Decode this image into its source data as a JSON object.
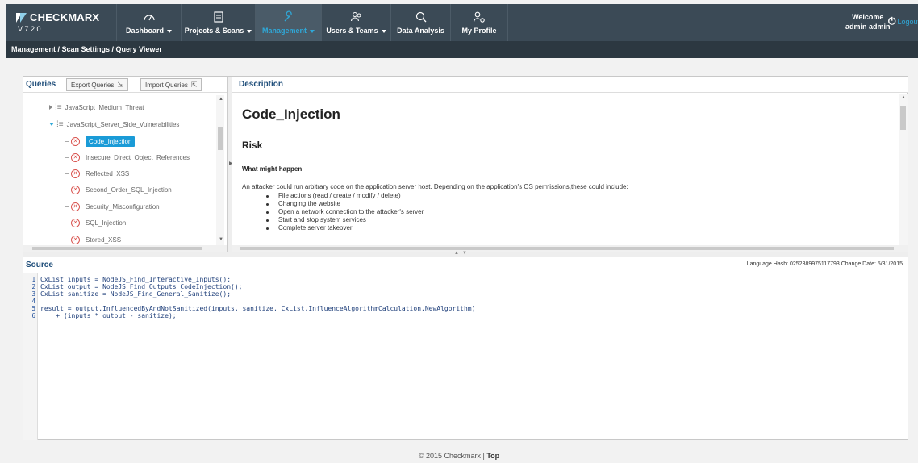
{
  "brand": {
    "name": "CHECKMARX",
    "version": "V 7.2.0"
  },
  "nav": {
    "items": [
      {
        "label": "Dashboard",
        "icon": "gauge-icon",
        "dropdown": true
      },
      {
        "label": "Projects & Scans",
        "icon": "document-icon",
        "dropdown": true
      },
      {
        "label": "Management",
        "icon": "wrench-icon",
        "dropdown": true,
        "active": true
      },
      {
        "label": "Users & Teams",
        "icon": "users-icon",
        "dropdown": true
      },
      {
        "label": "Data Analysis",
        "icon": "magnifier-icon",
        "dropdown": false
      },
      {
        "label": "My Profile",
        "icon": "user-gear-icon",
        "dropdown": false
      }
    ],
    "welcome_line1": "Welcome",
    "welcome_line2": "admin admin",
    "logout": "Logout"
  },
  "breadcrumb": "Management / Scan Settings / Query Viewer",
  "queries": {
    "title": "Queries",
    "export_label": "Export Queries",
    "import_label": "Import Queries",
    "groups": [
      {
        "label": "JavaScript_Medium_Threat",
        "expanded": false
      },
      {
        "label": "JavaScript_Server_Side_Vulnerabilities",
        "expanded": true
      }
    ],
    "items": [
      {
        "label": "Code_Injection",
        "selected": true
      },
      {
        "label": "Insecure_Direct_Object_References"
      },
      {
        "label": "Reflected_XSS"
      },
      {
        "label": "Second_Order_SQL_Injection"
      },
      {
        "label": "Security_Misconfiguration"
      },
      {
        "label": "SQL_Injection"
      },
      {
        "label": "Stored_XSS"
      }
    ]
  },
  "description": {
    "title": "Description",
    "heading": "Code_Injection",
    "risk": "Risk",
    "what_happens": "What might happen",
    "paragraph": "An attacker could run arbitrary code on the application server host. Depending on the application's OS permissions,these could include:",
    "bullets": [
      "File actions (read / create / modify / delete)",
      "Changing the website",
      "Open a network connection to the attacker's server",
      "Start and stop system services",
      "Complete server takeover"
    ]
  },
  "source": {
    "title": "Source",
    "lang_hash": "Language Hash: 0252389975117793 Change Date: 5/31/2015",
    "lines": [
      "CxList inputs = NodeJS_Find_Interactive_Inputs();",
      "CxList output = NodeJS_Find_Outputs_CodeInjection();",
      "CxList sanitize = NodeJS_Find_General_Sanitize();",
      "",
      "result = output.InfluencedByAndNotSanitized(inputs, sanitize, CxList.InfluenceAlgorithmCalculation.NewAlgorithm)",
      "    + (inputs * output - sanitize);"
    ],
    "line_numbers": [
      "1",
      "2",
      "3",
      "4",
      "5",
      "6"
    ]
  },
  "footer": {
    "copyright": "© 2015 Checkmarx | ",
    "top_link": "Top"
  },
  "colors": {
    "nav_bg": "#3b4a56",
    "accent": "#2fa8d8",
    "selected": "#1a9bd7",
    "error": "#d9534f"
  }
}
